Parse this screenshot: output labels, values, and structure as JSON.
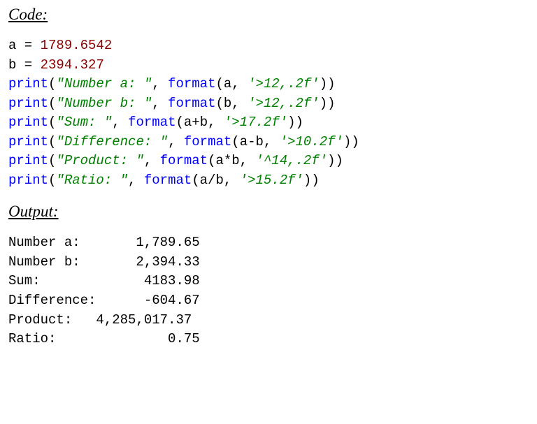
{
  "headings": {
    "code": "Code:",
    "output": "Output:"
  },
  "code": {
    "l1": {
      "var": "a",
      "eq": " = ",
      "val": "1789.6542"
    },
    "l2": {
      "var": "b",
      "eq": " = ",
      "val": "2394.327"
    },
    "l3": {
      "fn": "print",
      "open": "(",
      "str": "\"Number a: \"",
      "sep": ", ",
      "fmt": "format",
      "fopen": "(a, ",
      "fmtstr": "'>12,.2f'",
      "fclose": "))"
    },
    "l4": {
      "fn": "print",
      "open": "(",
      "str": "\"Number b: \"",
      "sep": ", ",
      "fmt": "format",
      "fopen": "(b, ",
      "fmtstr": "'>12,.2f'",
      "fclose": "))"
    },
    "l5": {
      "fn": "print",
      "open": "(",
      "str": "\"Sum: \"",
      "sep": ", ",
      "fmt": "format",
      "fopen": "(a+b, ",
      "fmtstr": "'>17.2f'",
      "fclose": "))"
    },
    "l6": {
      "fn": "print",
      "open": "(",
      "str": "\"Difference: \"",
      "sep": ", ",
      "fmt": "format",
      "fopen": "(a-b, ",
      "fmtstr": "'>10.2f'",
      "fclose": "))"
    },
    "l7": {
      "fn": "print",
      "open": "(",
      "str": "\"Product: \"",
      "sep": ", ",
      "fmt": "format",
      "fopen": "(a*b, ",
      "fmtstr": "'^14,.2f'",
      "fclose": "))"
    },
    "l8": {
      "fn": "print",
      "open": "(",
      "str": "\"Ratio: \"",
      "sep": ", ",
      "fmt": "format",
      "fopen": "(a/b, ",
      "fmtstr": "'>15.2f'",
      "fclose": "))"
    }
  },
  "output": {
    "l1": "Number a:       1,789.65",
    "l2": "Number b:       2,394.33",
    "l3": "Sum:             4183.98",
    "l4": "Difference:      -604.67",
    "l5": "Product:   4,285,017.37 ",
    "l6": "Ratio:              0.75"
  }
}
